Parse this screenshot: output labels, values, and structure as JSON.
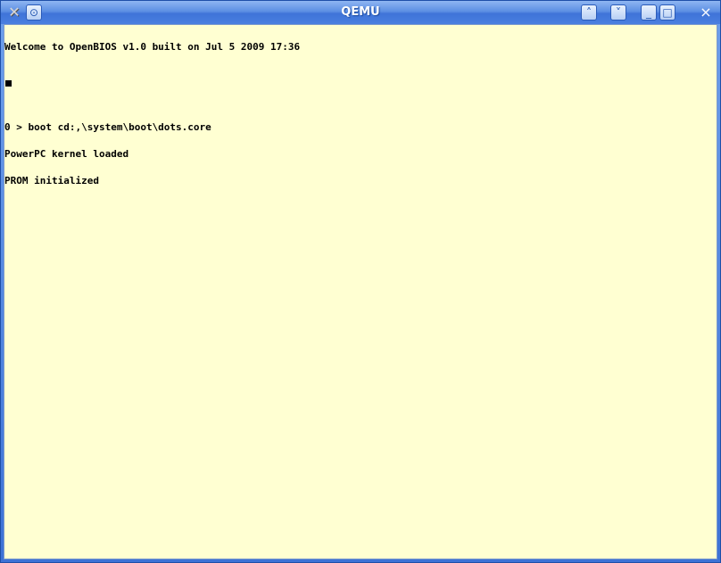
{
  "window": {
    "title": "QEMU"
  },
  "titlebar": {
    "app_icon": "qemu-x-icon",
    "left_buttons": [
      {
        "name": "window-menu-button",
        "glyph": "⊙"
      }
    ],
    "right_buttons": [
      {
        "name": "shade-up-button",
        "glyph": "˄"
      },
      {
        "name": "shade-down-button",
        "glyph": "˅"
      },
      {
        "name": "minimize-button",
        "glyph": "_"
      },
      {
        "name": "maximize-button",
        "glyph": "□"
      },
      {
        "name": "close-button",
        "glyph": "×"
      }
    ]
  },
  "console": {
    "lines": [
      "Welcome to OpenBIOS v1.0 built on Jul 5 2009 17:36",
      "",
      "",
      "0 > boot cd:,\\system\\boot\\dots.core",
      "PowerPC kernel loaded",
      "PROM initialized"
    ]
  },
  "colors": {
    "screen_background": "#ffffd2",
    "text": "#000000",
    "titlebar": "#4a7fe0"
  }
}
